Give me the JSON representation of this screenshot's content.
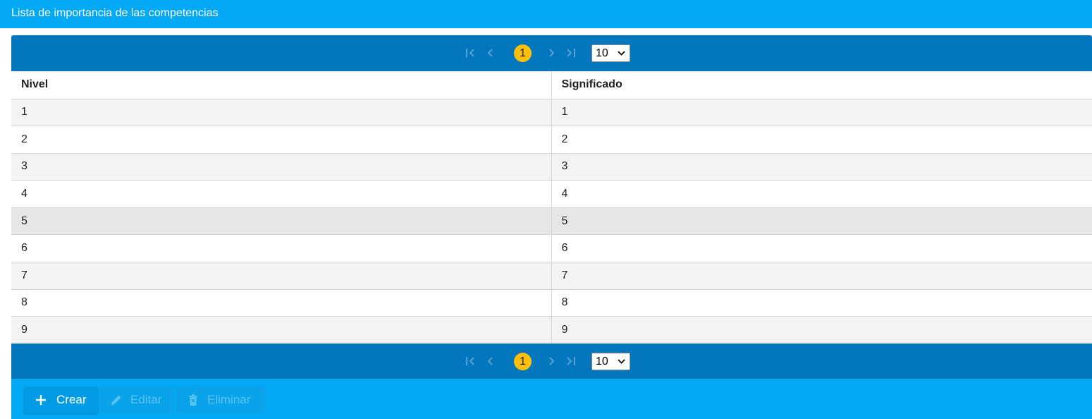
{
  "window": {
    "title": "Lista de importancia de las competencias"
  },
  "pager": {
    "current_page": "1",
    "page_size": "10",
    "icons": [
      "first-page-icon",
      "prev-page-icon",
      "next-page-icon",
      "last-page-icon"
    ]
  },
  "table": {
    "columns": [
      "Nivel",
      "Significado"
    ],
    "rows": [
      [
        "1",
        "1"
      ],
      [
        "2",
        "2"
      ],
      [
        "3",
        "3"
      ],
      [
        "4",
        "4"
      ],
      [
        "5",
        "5"
      ],
      [
        "6",
        "6"
      ],
      [
        "7",
        "7"
      ],
      [
        "8",
        "8"
      ],
      [
        "9",
        "9"
      ]
    ]
  },
  "toolbar": {
    "create_label": "Crear",
    "edit_label": "Editar",
    "delete_label": "Eliminar"
  },
  "colors": {
    "title_bar": "#03a9f4",
    "pager_bar": "#0277bd",
    "page_badge": "#ffc107"
  }
}
